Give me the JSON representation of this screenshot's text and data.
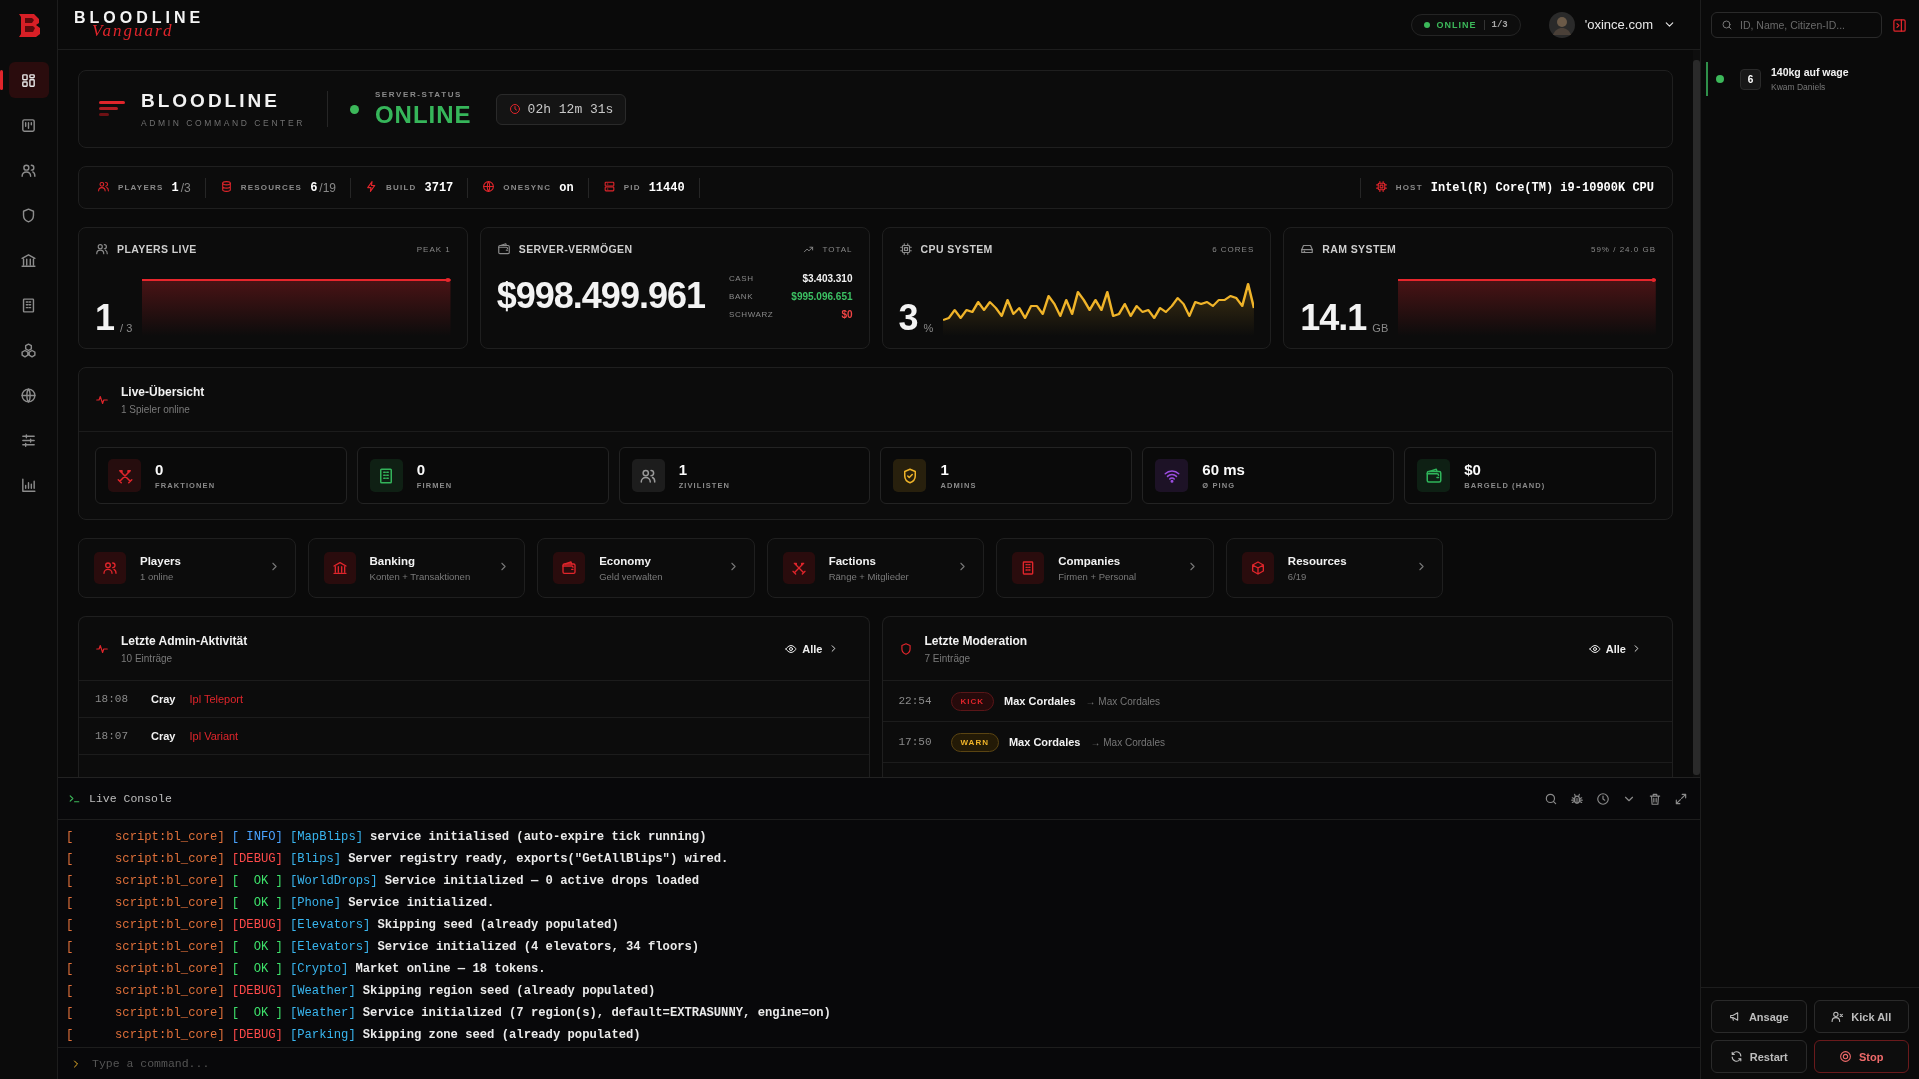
{
  "nav": [
    {
      "selected": true
    },
    {
      "selected": false
    },
    {
      "selected": false
    },
    {
      "selected": false
    },
    {
      "selected": false
    },
    {
      "selected": false
    },
    {
      "selected": false
    },
    {
      "selected": false
    },
    {
      "selected": false
    },
    {
      "selected": false
    }
  ],
  "top_bar": {
    "brand": "BLOODLINE",
    "brand_script": "Vanguard",
    "status": "ONLINE",
    "status_count": "1/3",
    "user": "'oxince.com"
  },
  "header": {
    "title": "BLOODLINE",
    "subtitle": "ADMIN COMMAND CENTER",
    "status_label": "SERVER-STATUS",
    "status": "ONLINE",
    "uptime": "02h 12m 31s"
  },
  "info_bar": {
    "items": [
      {
        "label": "PLAYERS",
        "value": "1",
        "total": "/3"
      },
      {
        "label": "RESOURCES",
        "value": "6",
        "total": "/19"
      },
      {
        "label": "BUILD",
        "value": "3717"
      },
      {
        "label": "ONESYNC",
        "value": "on"
      },
      {
        "label": "PID",
        "value": "11440"
      }
    ],
    "host": {
      "label": "HOST",
      "value": "Intel(R) Core(TM) i9-10900K CPU"
    }
  },
  "stat_cards": [
    {
      "kind": "trend",
      "title": "PLAYERS LIVE",
      "badge": "PEAK 1",
      "value": "1",
      "unit": "/ 3",
      "color": "#e8262c"
    },
    {
      "kind": "money",
      "title": "SERVER-VERMÖGEN",
      "badge": "TOTAL",
      "value": "$998.499.961",
      "breakdown": [
        {
          "label": "CASH",
          "value": "$3.403.310",
          "color": "#f2f2f2"
        },
        {
          "label": "BANK",
          "value": "$995.096.651",
          "color": "#3cc163"
        },
        {
          "label": "SCHWARZ",
          "value": "$0",
          "color": "#f04444"
        }
      ]
    },
    {
      "kind": "wave",
      "title": "CPU SYSTEM",
      "badge": "6 CORES",
      "value": "3",
      "unit": "%",
      "color": "#f0b429"
    },
    {
      "kind": "trend",
      "title": "RAM SYSTEM",
      "badge": "59% / 24.0 GB",
      "value": "14.1",
      "unit": "GB",
      "color": "#e8262c"
    }
  ],
  "live": {
    "title": "Live-Übersicht",
    "subtitle": "1 Spieler online",
    "tiles": [
      {
        "value": "0",
        "label": "FRAKTIONEN",
        "color": "#e0252b"
      },
      {
        "value": "0",
        "label": "FIRMEN",
        "color": "#33b35a"
      },
      {
        "value": "1",
        "label": "ZIVILISTEN",
        "color": "#9a9a9a"
      },
      {
        "value": "1",
        "label": "ADMINS",
        "color": "#f0b429"
      },
      {
        "value": "60 ms",
        "label": "Ø PING",
        "color": "#9b4de0"
      },
      {
        "value": "$0",
        "label": "BARGELD (HAND)",
        "color": "#2fb55a"
      }
    ]
  },
  "nav_cards": [
    {
      "title": "Players",
      "subtitle": "1 online"
    },
    {
      "title": "Banking",
      "subtitle": "Konten + Transaktionen"
    },
    {
      "title": "Economy",
      "subtitle": "Geld verwalten"
    },
    {
      "title": "Factions",
      "subtitle": "Ränge + Mitglieder"
    },
    {
      "title": "Companies",
      "subtitle": "Firmen + Personal"
    },
    {
      "title": "Resources",
      "subtitle": "6/19"
    }
  ],
  "activity": {
    "title": "Letzte Admin-Aktivität",
    "subtitle": "10 Einträge",
    "link": "Alle",
    "rows": [
      {
        "time": "18:08",
        "user": "Cray",
        "action": "Ipl Teleport"
      },
      {
        "time": "18:07",
        "user": "Cray",
        "action": "Ipl Variant"
      }
    ]
  },
  "moderation": {
    "title": "Letzte Moderation",
    "subtitle": "7 Einträge",
    "link": "Alle",
    "rows": [
      {
        "time": "22:54",
        "kind": "kick",
        "badge": "KICK",
        "target": "Max Cordales",
        "actor": "→ Max Cordales"
      },
      {
        "time": "17:50",
        "kind": "warn",
        "badge": "WARN",
        "target": "Max Cordales",
        "actor": "→ Max Cordales"
      }
    ]
  },
  "console": {
    "title": "Live Console",
    "placeholder": "Type a command...",
    "lines": [
      {
        "bracket": "[",
        "source": "script:bl_core]",
        "kind": "info",
        "tag": "[ INFO]",
        "module": "[MapBlips]",
        "message": "service initialised (auto-expire tick running)"
      },
      {
        "bracket": "[",
        "source": "script:bl_core]",
        "kind": "debug",
        "tag": "[DEBUG]",
        "module": "[Blips]",
        "message": "Server registry ready, exports(\"GetAllBlips\") wired."
      },
      {
        "bracket": "[",
        "source": "script:bl_core]",
        "kind": "ok",
        "tag": "[  OK ]",
        "module": "[WorldDrops]",
        "message": "Service initialized — 0 active drops loaded"
      },
      {
        "bracket": "[",
        "source": "script:bl_core]",
        "kind": "ok",
        "tag": "[  OK ]",
        "module": "[Phone]",
        "message": "Service initialized."
      },
      {
        "bracket": "[",
        "source": "script:bl_core]",
        "kind": "debug",
        "tag": "[DEBUG]",
        "module": "[Elevators]",
        "message": "Skipping seed (already populated)"
      },
      {
        "bracket": "[",
        "source": "script:bl_core]",
        "kind": "ok",
        "tag": "[  OK ]",
        "module": "[Elevators]",
        "message": "Service initialized (4 elevators, 34 floors)"
      },
      {
        "bracket": "[",
        "source": "script:bl_core]",
        "kind": "ok",
        "tag": "[  OK ]",
        "module": "[Crypto]",
        "message": "Market online — 18 tokens."
      },
      {
        "bracket": "[",
        "source": "script:bl_core]",
        "kind": "debug",
        "tag": "[DEBUG]",
        "module": "[Weather]",
        "message": "Skipping region seed (already populated)"
      },
      {
        "bracket": "[",
        "source": "script:bl_core]",
        "kind": "ok",
        "tag": "[  OK ]",
        "module": "[Weather]",
        "message": "Service initialized (7 region(s), default=EXTRASUNNY, engine=on)"
      },
      {
        "bracket": "[",
        "source": "script:bl_core]",
        "kind": "debug",
        "tag": "[DEBUG]",
        "module": "[Parking]",
        "message": "Skipping zone seed (already populated)"
      }
    ]
  },
  "side_panel": {
    "search": {
      "placeholder": "ID, Name, Citizen-ID..."
    },
    "players": [
      {
        "id": "6",
        "name": "140kg auf wage",
        "subtitle": "Kwam Daniels",
        "online": true
      }
    ],
    "actions": [
      {
        "label": "Ansage",
        "kind": "default"
      },
      {
        "label": "Kick All",
        "kind": "default"
      },
      {
        "label": "Restart",
        "kind": "default"
      },
      {
        "label": "Stop",
        "kind": "danger"
      }
    ]
  }
}
